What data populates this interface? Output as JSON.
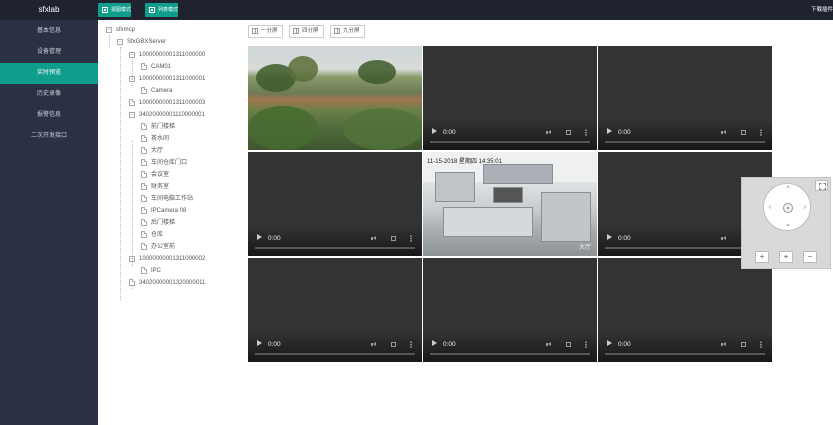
{
  "app": {
    "brand": "sfxlab",
    "mode_buttons": [
      "视图模式",
      "列表模式"
    ],
    "download_text": "下载插件"
  },
  "sidebar": {
    "items": [
      {
        "label": "基本信息",
        "active": false
      },
      {
        "label": "设备管理",
        "active": false
      },
      {
        "label": "实时预览",
        "active": true
      },
      {
        "label": "历史录像",
        "active": false
      },
      {
        "label": "报警信息",
        "active": false
      },
      {
        "label": "二次开发接口",
        "active": false
      }
    ]
  },
  "tree": {
    "root": "sfxmcp",
    "server": "SfxGBXServer",
    "nodes": [
      {
        "label": "10000000001311000000",
        "type": "folder"
      },
      {
        "label": "CAM01",
        "type": "leaf"
      },
      {
        "label": "10000000001311000001",
        "type": "folder"
      },
      {
        "label": "Camera",
        "type": "leaf"
      },
      {
        "label": "10000000001311000003",
        "type": "leaf"
      },
      {
        "label": "34020000001110000001",
        "type": "folder"
      },
      {
        "label": "前门楼梯",
        "type": "leaf"
      },
      {
        "label": "茶水间",
        "type": "leaf"
      },
      {
        "label": "大厅",
        "type": "leaf"
      },
      {
        "label": "车间仓库门口",
        "type": "leaf"
      },
      {
        "label": "会议室",
        "type": "leaf"
      },
      {
        "label": "财务室",
        "type": "leaf"
      },
      {
        "label": "车间电脑工作站",
        "type": "leaf"
      },
      {
        "label": "IPCamera 08",
        "type": "leaf"
      },
      {
        "label": "后门楼梯",
        "type": "leaf"
      },
      {
        "label": "仓库",
        "type": "leaf"
      },
      {
        "label": "办公室前",
        "type": "leaf"
      },
      {
        "label": "10000000001311000002",
        "type": "folder"
      },
      {
        "label": "IPC",
        "type": "leaf"
      },
      {
        "label": "34020000001320000011",
        "type": "leaf"
      }
    ]
  },
  "split_buttons": [
    "一分屏",
    "四分屏",
    "九分屏"
  ],
  "video": {
    "time": "0:00",
    "cell2_stamp": "11-15-2018 星期四 14:35:01",
    "cell2_caption": "大厅"
  }
}
